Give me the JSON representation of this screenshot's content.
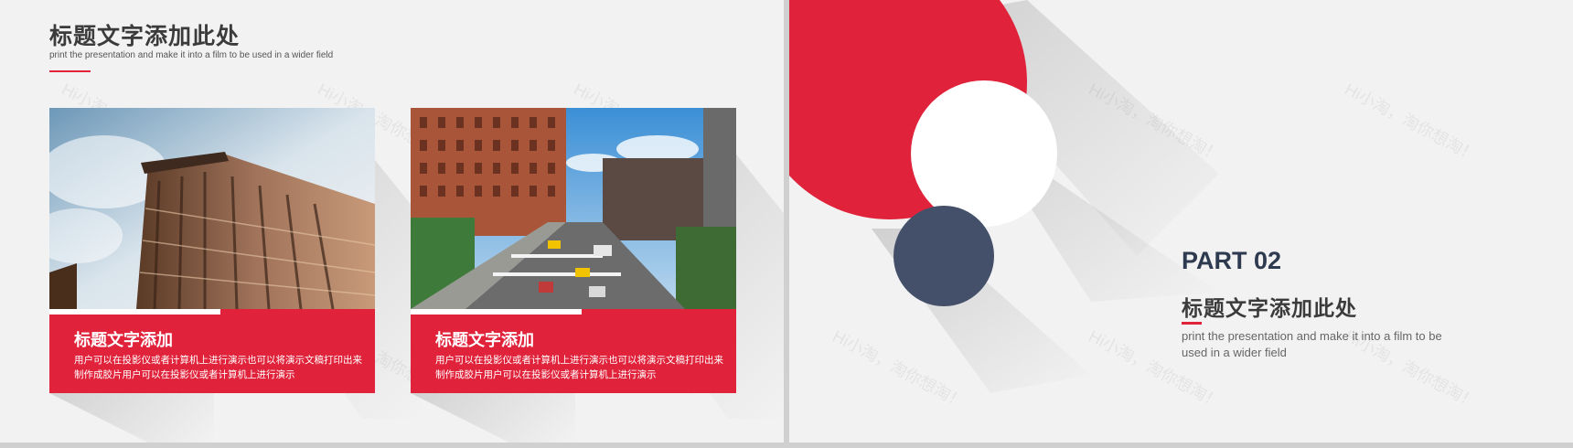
{
  "left_slide": {
    "title": "标题文字添加此处",
    "subtitle": "print the presentation and make it into a film to be used in a wider field",
    "cards": [
      {
        "title": "标题文字添加",
        "text": "用户可以在投影仪或者计算机上进行演示也可以将演示文稿打印出来制作成胶片用户可以在投影仪或者计算机上进行演示"
      },
      {
        "title": "标题文字添加",
        "text": "用户可以在投影仪或者计算机上进行演示也可以将演示文稿打印出来制作成胶片用户可以在投影仪或者计算机上进行演示"
      }
    ]
  },
  "right_slide": {
    "part": "PART 02",
    "title": "标题文字添加此处",
    "subtitle": "print the presentation and make it into a film to be used in a wider field"
  },
  "watermark_text": "Hi小淘，淘你想淘！",
  "colors": {
    "accent_red": "#e0223a",
    "navy": "#44506a",
    "background": "#f2f2f2"
  }
}
